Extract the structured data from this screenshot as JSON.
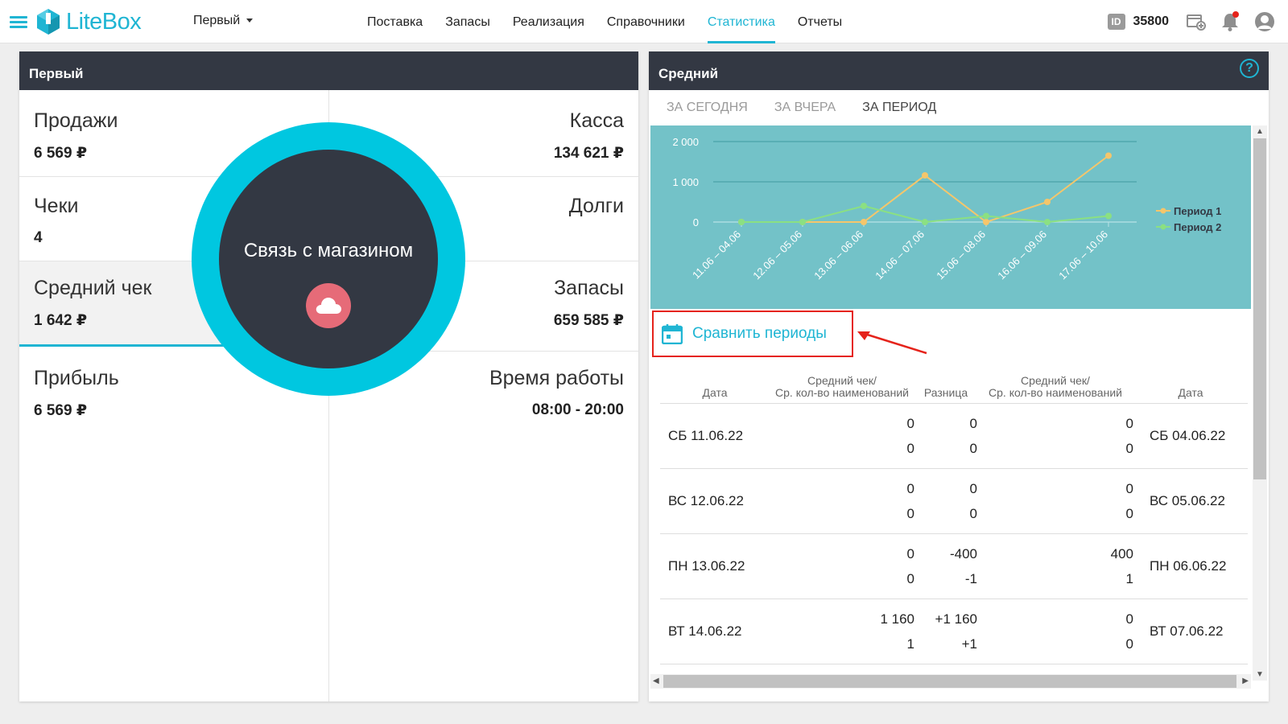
{
  "app": {
    "brand": "LiteBox",
    "store_selector": "Первый",
    "nav": [
      "Поставка",
      "Запасы",
      "Реализация",
      "Справочники",
      "Статистика",
      "Отчеты"
    ],
    "active_nav": "Статистика",
    "id_badge": "ID",
    "id_number": "35800"
  },
  "left_panel": {
    "title": "Первый",
    "metrics": {
      "sales": {
        "label": "Продажи",
        "value": "6 569 ₽"
      },
      "cash": {
        "label": "Касса",
        "value": "134 621 ₽"
      },
      "checks": {
        "label": "Чеки",
        "value": "4"
      },
      "debts": {
        "label": "Долги",
        "value": ""
      },
      "avg_check": {
        "label": "Средний чек",
        "value": "1 642 ₽"
      },
      "stock": {
        "label": "Запасы",
        "value": "659 585 ₽"
      },
      "profit": {
        "label": "Прибыль",
        "value": "6 569 ₽"
      },
      "hours": {
        "label": "Время работы",
        "value": "08:00 - 20:00"
      }
    },
    "overlay": {
      "text": "Связь с магазином"
    }
  },
  "right_panel": {
    "title": "Средний",
    "help": "?",
    "tabs": [
      "За сегодня",
      "За вчера",
      "За период"
    ],
    "active_tab": "За период",
    "compare_label": "Сравнить периоды",
    "table": {
      "headers": {
        "date_left": "Дата",
        "avg1_line1": "Средний чек/",
        "avg1_line2": "Ср. кол-во наименований",
        "diff": "Разница",
        "avg2_line1": "Средний чек/",
        "avg2_line2": "Ср. кол-во наименований",
        "date_right": "Дата"
      },
      "rows": [
        {
          "date1": "СБ 11.06.22",
          "a1": "0",
          "b1": "0",
          "da": "0",
          "db": "0",
          "a2": "0",
          "b2": "0",
          "date2": "СБ 04.06.22"
        },
        {
          "date1": "ВС 12.06.22",
          "a1": "0",
          "b1": "0",
          "da": "0",
          "db": "0",
          "a2": "0",
          "b2": "0",
          "date2": "ВС 05.06.22"
        },
        {
          "date1": "ПН 13.06.22",
          "a1": "0",
          "b1": "0",
          "da": "-400",
          "db": "-1",
          "a2": "400",
          "b2": "1",
          "date2": "ПН 06.06.22"
        },
        {
          "date1": "ВТ 14.06.22",
          "a1": "1 160",
          "b1": "1",
          "da": "+1 160",
          "db": "+1",
          "a2": "0",
          "b2": "0",
          "date2": "ВТ 07.06.22"
        }
      ]
    }
  },
  "chart_data": {
    "type": "line",
    "categories": [
      "11.06 – 04.06",
      "12.06 – 05.06",
      "13.06 – 06.06",
      "14.06 – 07.06",
      "15.06 – 08.06",
      "16.06 – 09.06",
      "17.06 – 10.06"
    ],
    "ytick_labels": [
      "0",
      "1 000",
      "2 000"
    ],
    "yticks": [
      0,
      1000,
      2000
    ],
    "ylim": [
      0,
      2000
    ],
    "grid": true,
    "legend": "right",
    "series": [
      {
        "name": "Период 1",
        "color": "#f5c66b",
        "values": [
          0,
          0,
          0,
          1160,
          0,
          500,
          1650
        ]
      },
      {
        "name": "Период 2",
        "color": "#8be082",
        "values": [
          0,
          0,
          400,
          0,
          150,
          0,
          150
        ]
      }
    ]
  },
  "colors": {
    "accent": "#1fb5d3",
    "header_bg": "#333843",
    "chart_bg": "#73c2c8",
    "overlay_ring": "#00c7e0",
    "cloud_btn": "#e66b78",
    "highlight_red": "#e5231b"
  }
}
